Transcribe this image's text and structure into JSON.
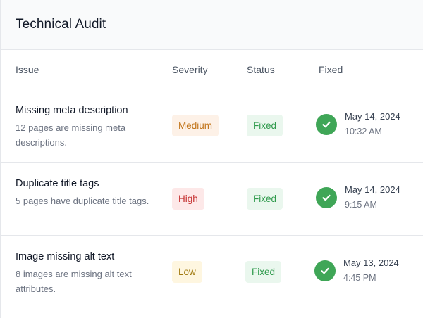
{
  "card": {
    "title": "Technical Audit"
  },
  "columns": {
    "issue": "Issue",
    "severity": "Severity",
    "status": "Status",
    "fixed": "Fixed"
  },
  "rows": [
    {
      "title": "Missing meta description",
      "description": "12 pages are missing meta descriptions.",
      "severity": "Medium",
      "status": "Fixed",
      "date": "May 14, 2024",
      "time": "10:32 AM"
    },
    {
      "title": "Duplicate title tags",
      "description": "5 pages have duplicate title tags.",
      "severity": "High",
      "status": "Fixed",
      "date": "May 14, 2024",
      "time": "9:15 AM"
    },
    {
      "title": "Image missing alt text",
      "description": "8 images are missing alt text attributes.",
      "severity": "Low",
      "status": "Fixed",
      "date": "May 13, 2024",
      "time": "4:45 PM"
    }
  ],
  "icons": {
    "fixed": "check-icon"
  },
  "colors": {
    "medium_bg": "#fdf1e7",
    "medium_text": "#c2751b",
    "high_bg": "#fde8e8",
    "high_text": "#c53030",
    "low_bg": "#fef6e0",
    "low_text": "#a07a10",
    "fixed_bg": "#eaf7ee",
    "fixed_text": "#2f9a4c",
    "check": "#3fa657"
  }
}
